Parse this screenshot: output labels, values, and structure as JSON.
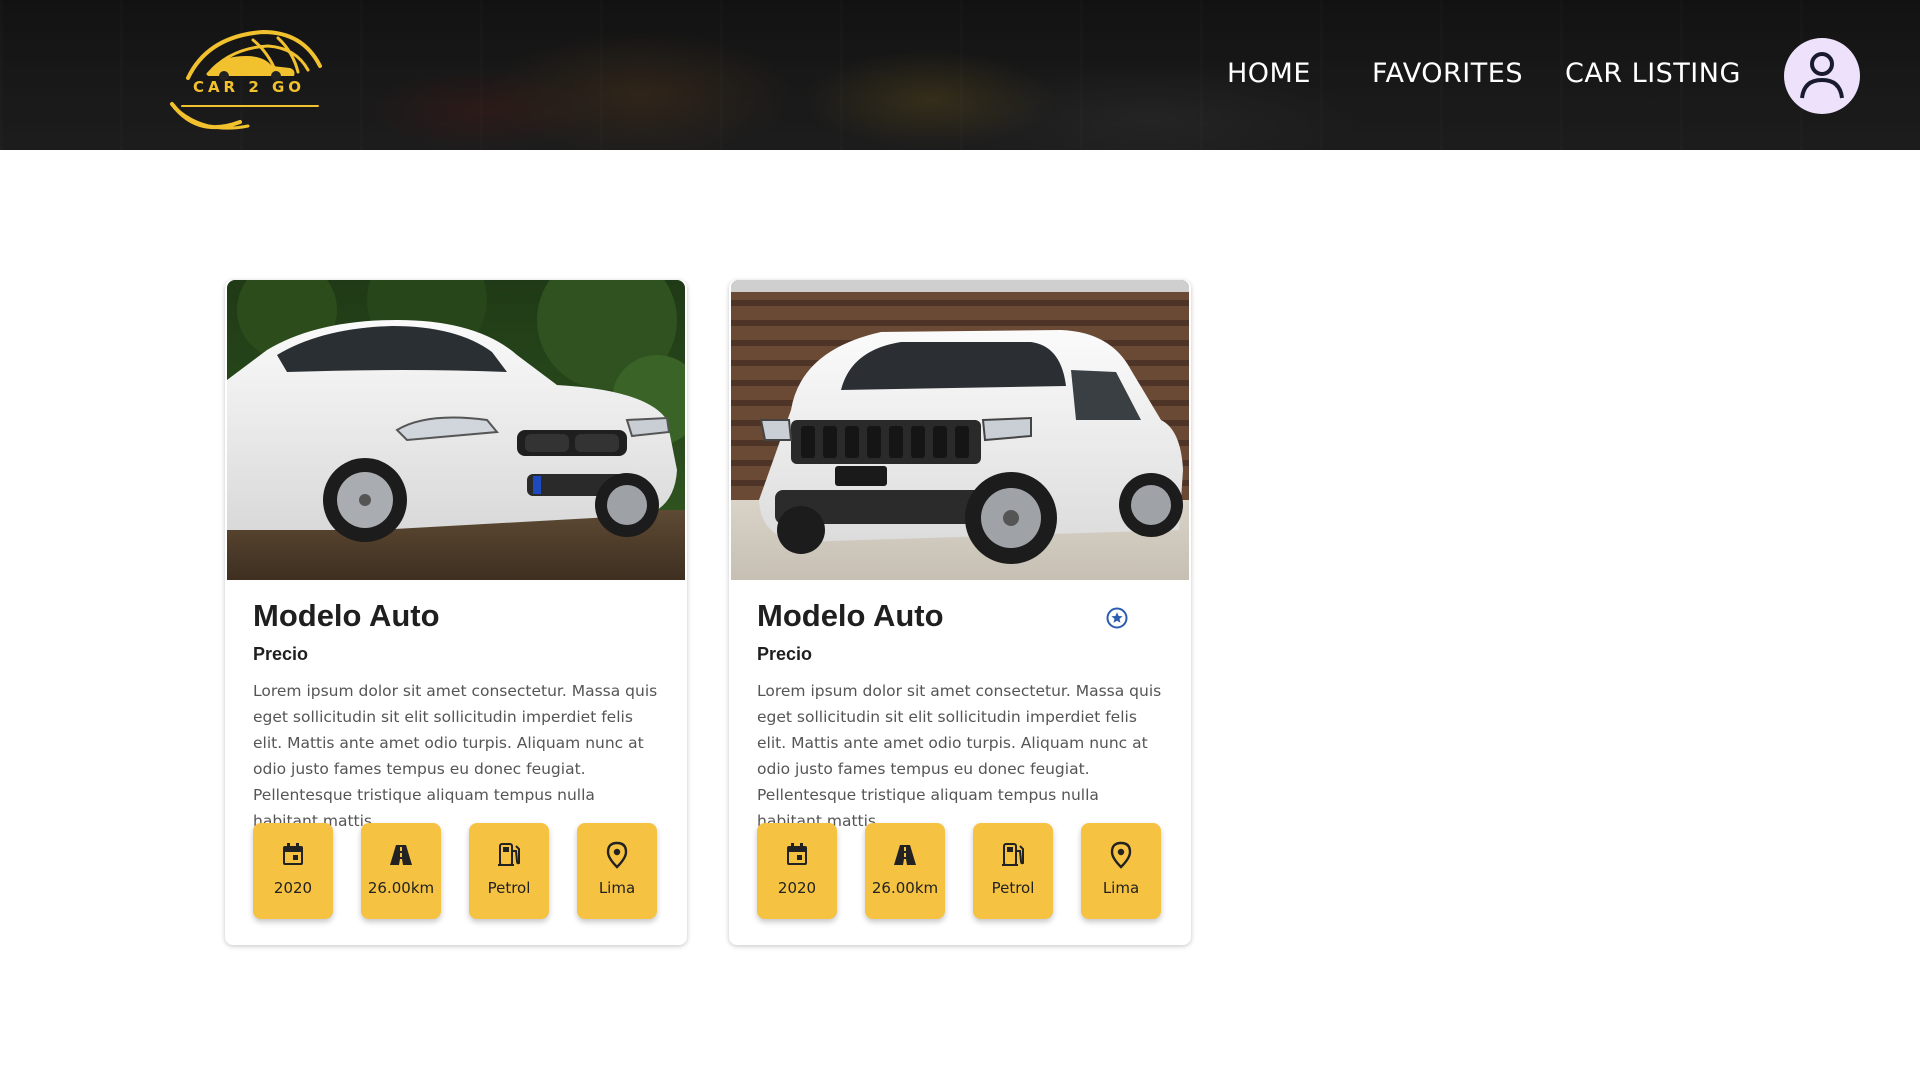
{
  "header": {
    "brand": "CAR 2 GO",
    "nav": [
      {
        "label": "HOME"
      },
      {
        "label": "FAVORITES"
      },
      {
        "label": "CAR LISTING"
      }
    ],
    "avatar_icon": "user-icon"
  },
  "cards": [
    {
      "image": "white-sedan-photo",
      "title": "Modelo Auto",
      "price_label": "Precio",
      "favorite": false,
      "description": "Lorem ipsum dolor sit amet consectetur. Massa quis eget sollicitudin sit elit sollicitudin imperdiet felis elit. Mattis ante amet odio turpis. Aliquam nunc at odio justo fames tempus eu donec feugiat. Pellentesque tristique aliquam tempus nulla habitant mattis.",
      "specs": [
        {
          "icon": "calendar-icon",
          "value": "2020"
        },
        {
          "icon": "road-icon",
          "value": "26.00km"
        },
        {
          "icon": "fuel-pump-icon",
          "value": "Petrol"
        },
        {
          "icon": "location-pin-icon",
          "value": "Lima"
        }
      ]
    },
    {
      "image": "white-suv-photo",
      "title": "Modelo Auto",
      "price_label": "Precio",
      "favorite": true,
      "favorite_icon": "star-circle-icon",
      "description": "Lorem ipsum dolor sit amet consectetur. Massa quis eget sollicitudin sit elit sollicitudin imperdiet felis elit. Mattis ante amet odio turpis. Aliquam nunc at odio justo fames tempus eu donec feugiat. Pellentesque tristique aliquam tempus nulla habitant mattis.",
      "specs": [
        {
          "icon": "calendar-icon",
          "value": "2020"
        },
        {
          "icon": "road-icon",
          "value": "26.00km"
        },
        {
          "icon": "fuel-pump-icon",
          "value": "Petrol"
        },
        {
          "icon": "location-pin-icon",
          "value": "Lima"
        }
      ]
    }
  ],
  "colors": {
    "accent": "#f5c242",
    "header_bg": "#222222",
    "avatar_bg": "#ede1fb",
    "favorite": "#2a5db0"
  }
}
